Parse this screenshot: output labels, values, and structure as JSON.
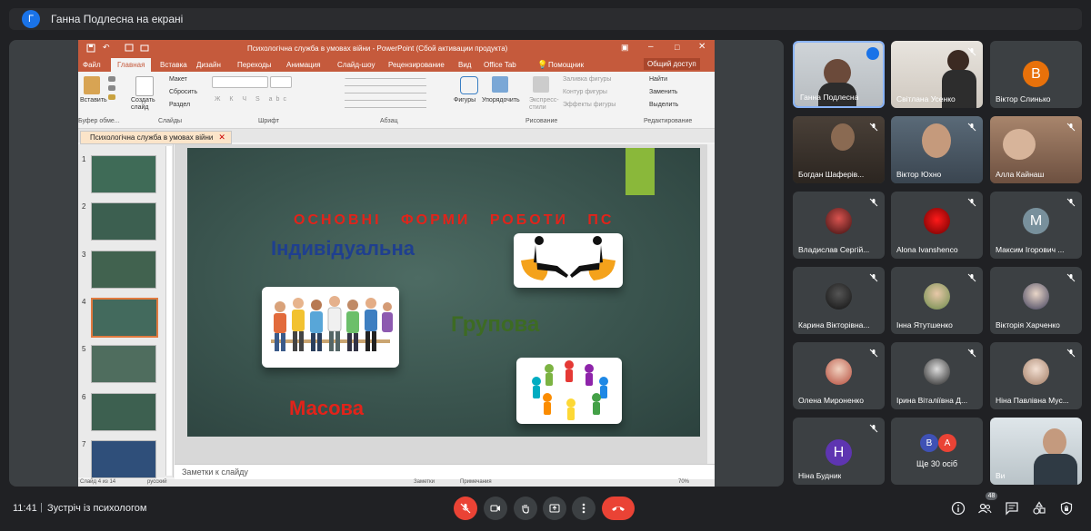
{
  "presenter_banner": {
    "avatar_letter": "Г",
    "text": "Ганна Подлесна на екрані"
  },
  "powerpoint": {
    "window_title": "Психологічна служба в умовах війни - PowerPoint (Сбой активации продукта)",
    "tabs": [
      "Файл",
      "Главная",
      "Вставка",
      "Дизайн",
      "Переходы",
      "Анимация",
      "Слайд-шоу",
      "Рецензирование",
      "Вид",
      "Office Tab",
      "Помощник",
      "Общий доступ"
    ],
    "ribbon": {
      "insert_label": "Вставить",
      "clipboard_group": "Буфер обме...",
      "create_slide_label": "Создать слайд",
      "layout_label": "Макет",
      "reset_label": "Сбросить",
      "section_label": "Раздел",
      "slides_group": "Слайды",
      "font_group": "Шрифт",
      "font_buttons": "Ж К Ч S abc",
      "paragraph_group": "Абзац",
      "shapes_label": "Фигуры",
      "arrange_label": "Упорядочить",
      "express_styles_label": "Экспресс-стили",
      "fill_label": "Заливка фигуры",
      "outline_label": "Контур фигуры",
      "effects_label": "Эффекты фигуры",
      "drawing_group": "Рисование",
      "find_label": "Найти",
      "replace_label": "Заменить",
      "select_label": "Выделить",
      "editing_group": "Редактирование"
    },
    "doc_tab": "Психологічна служба в умовах війни",
    "slide_numbers": [
      "1",
      "2",
      "3",
      "4",
      "5",
      "6",
      "7"
    ],
    "slide": {
      "title": "ОСНОВНІ ФОРМИ РОБОТИ ПС",
      "individual": "Індивідуальна",
      "group": "Групова",
      "mass": "Масова"
    },
    "notes_placeholder": "Заметки к слайду",
    "status_bar": {
      "slide_info": "Слайд 4 из 14",
      "language": "русский",
      "notes": "Заметки",
      "comments": "Примечания",
      "zoom": "70%"
    }
  },
  "participants": [
    {
      "name": "Ганна Подлесна",
      "type": "video",
      "speaking": true
    },
    {
      "name": "Світлана Усенко",
      "type": "video",
      "muted": true
    },
    {
      "name": "Віктор Слинько",
      "type": "avatar",
      "letter": "В",
      "color": "#e8710a"
    },
    {
      "name": "Богдан Шаферів...",
      "type": "video",
      "muted": true
    },
    {
      "name": "Віктор Юхно",
      "type": "video",
      "muted": true
    },
    {
      "name": "Алла Кайнаш",
      "type": "video",
      "muted": true
    },
    {
      "name": "Владислав Сергій...",
      "type": "photo",
      "muted": true
    },
    {
      "name": "Alona Ivanshenco",
      "type": "photo",
      "muted": true
    },
    {
      "name": "Максим Ігорович ...",
      "type": "avatar",
      "letter": "M",
      "color": "#78909c",
      "muted": true
    },
    {
      "name": "Карина Вікторівна...",
      "type": "photo",
      "muted": true
    },
    {
      "name": "Інна Ятутшенко",
      "type": "photo",
      "muted": true
    },
    {
      "name": "Вікторія Харченко",
      "type": "photo",
      "muted": true
    },
    {
      "name": "Олена Мироненко",
      "type": "photo",
      "muted": true
    },
    {
      "name": "Ірина Віталіївна Д...",
      "type": "photo",
      "muted": true
    },
    {
      "name": "Ніна Павлівна Мус...",
      "type": "photo",
      "muted": true
    },
    {
      "name": "Ніна Будник",
      "type": "avatar",
      "letter": "Н",
      "color": "#5e35b1",
      "muted": true
    },
    {
      "name": "Ще 30 осіб",
      "type": "more",
      "letters": [
        "В",
        "А"
      ]
    },
    {
      "name": "Ви",
      "type": "video"
    }
  ],
  "bottom_bar": {
    "time": "11:41",
    "separator": "|",
    "meeting_name": "Зустріч із психологом",
    "people_count": "48"
  },
  "colors": {
    "background": "#202124",
    "tile": "#3c4043",
    "danger": "#ea4335",
    "accent": "#1a73e8",
    "ppt_brand": "#c55a3c"
  }
}
